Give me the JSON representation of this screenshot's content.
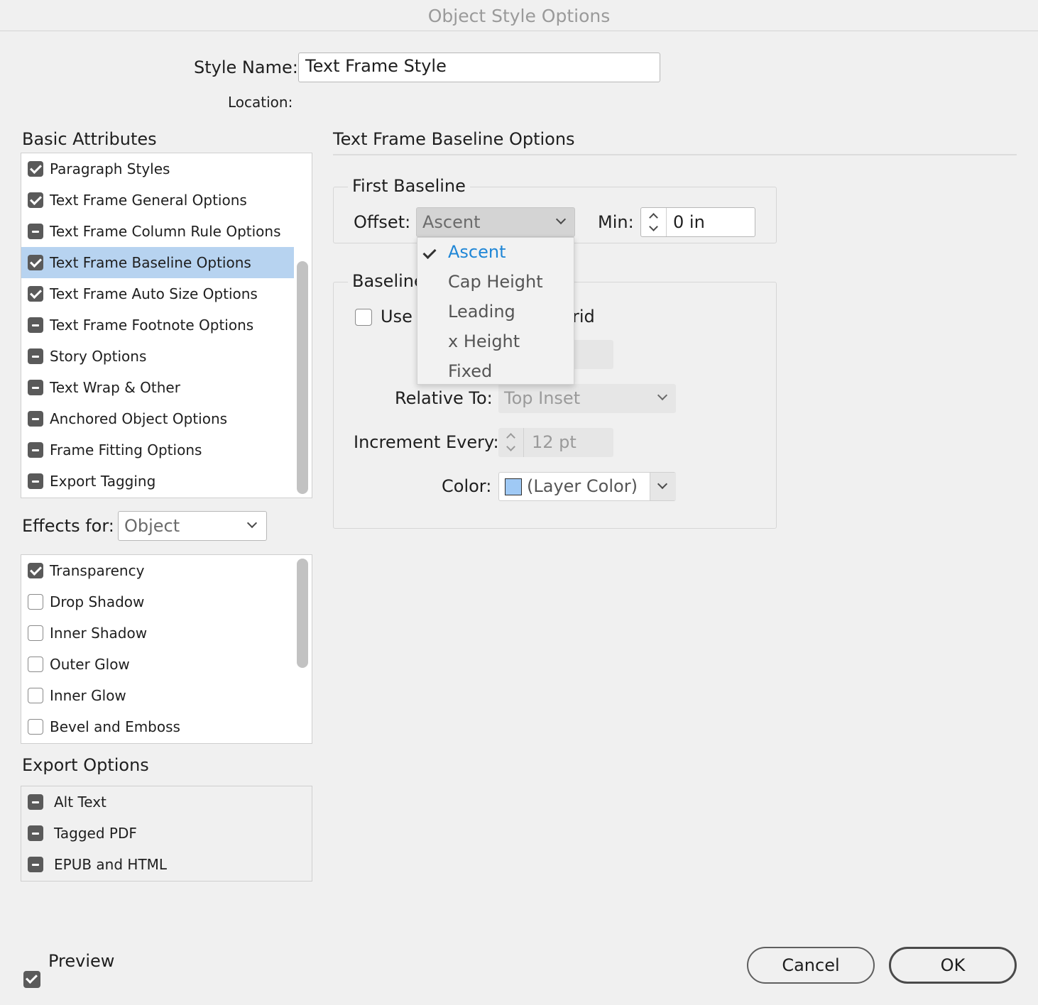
{
  "window": {
    "title": "Object Style Options"
  },
  "style_name": {
    "label": "Style Name:",
    "value": "Text Frame Style"
  },
  "location": {
    "label": "Location:"
  },
  "basic_attributes": {
    "title": "Basic Attributes",
    "items": [
      {
        "label": "Paragraph Styles",
        "state": "checked"
      },
      {
        "label": "Text Frame General Options",
        "state": "checked"
      },
      {
        "label": "Text Frame Column Rule Options",
        "state": "mixed"
      },
      {
        "label": "Text Frame Baseline Options",
        "state": "checked",
        "selected": true
      },
      {
        "label": "Text Frame Auto Size Options",
        "state": "checked"
      },
      {
        "label": "Text Frame Footnote Options",
        "state": "mixed"
      },
      {
        "label": "Story Options",
        "state": "mixed"
      },
      {
        "label": "Text Wrap & Other",
        "state": "mixed"
      },
      {
        "label": "Anchored Object Options",
        "state": "mixed"
      },
      {
        "label": "Frame Fitting Options",
        "state": "mixed"
      },
      {
        "label": "Export Tagging",
        "state": "mixed"
      }
    ]
  },
  "effects_for": {
    "label": "Effects for:",
    "value": "Object",
    "items": [
      {
        "label": "Transparency",
        "state": "checked"
      },
      {
        "label": "Drop Shadow",
        "state": "empty"
      },
      {
        "label": "Inner Shadow",
        "state": "empty"
      },
      {
        "label": "Outer Glow",
        "state": "empty"
      },
      {
        "label": "Inner Glow",
        "state": "empty"
      },
      {
        "label": "Bevel and Emboss",
        "state": "empty"
      }
    ]
  },
  "export_options": {
    "title": "Export Options",
    "items": [
      {
        "label": "Alt Text",
        "state": "mixed"
      },
      {
        "label": "Tagged PDF",
        "state": "mixed"
      },
      {
        "label": "EPUB and HTML",
        "state": "mixed"
      }
    ]
  },
  "panel": {
    "title": "Text Frame Baseline Options",
    "first_baseline": {
      "legend": "First Baseline",
      "offset_label": "Offset:",
      "offset_value": "Ascent",
      "min_label": "Min:",
      "min_value": "0 in"
    },
    "offset_menu": {
      "items": [
        "Ascent",
        "Cap Height",
        "Leading",
        "x Height",
        "Fixed"
      ],
      "selected": "Ascent"
    },
    "baseline_grid": {
      "legend_visible": "Baseline",
      "use_label_visible": "Use",
      "use_checked": false,
      "grid_fragment": "rid",
      "relative_to_label": "Relative To:",
      "relative_to_value": "Top Inset",
      "increment_label": "Increment Every:",
      "increment_value": "12 pt",
      "color_label": "Color:",
      "color_value": "(Layer Color)",
      "swatch_color": "#9fc9f5"
    }
  },
  "footer": {
    "preview_label": "Preview",
    "preview_checked": true,
    "cancel_label": "Cancel",
    "ok_label": "OK"
  },
  "colors": {
    "selection": "#b7d3f0",
    "menu_accent": "#1f86d6",
    "background": "#f0f0f0"
  }
}
